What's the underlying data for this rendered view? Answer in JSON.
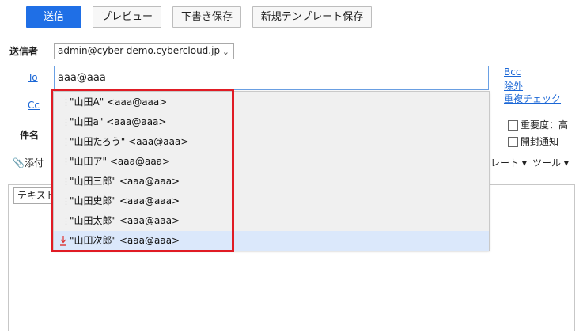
{
  "toolbar": {
    "send": "送信",
    "preview": "プレビュー",
    "save_draft": "下書き保存",
    "save_template": "新規テンプレート保存"
  },
  "sender": {
    "label": "送信者",
    "value": "admin@cyber-demo.cybercloud.jp"
  },
  "to": {
    "label": "To",
    "value": "aaa@aaa"
  },
  "cc": {
    "label": "Cc"
  },
  "subject": {
    "label": "件名"
  },
  "links": {
    "bcc": "Bcc",
    "exclude": "除外",
    "dup_check": "重複チェック"
  },
  "options": {
    "priority": "重要度：高",
    "read_receipt": "開封通知"
  },
  "attach": {
    "label": "添付"
  },
  "format": {
    "label": "テキスト"
  },
  "right_tools": {
    "template": "レート",
    "tools": "ツール"
  },
  "suggestions": [
    {
      "name": "\"山田A\"",
      "email": "<aaa@aaa>"
    },
    {
      "name": "\"山田a\"",
      "email": "<aaa@aaa>"
    },
    {
      "name": "\"山田たろう\"",
      "email": "<aaa@aaa>"
    },
    {
      "name": "\"山田ア\"",
      "email": "<aaa@aaa>"
    },
    {
      "name": "\"山田三郎\"",
      "email": "<aaa@aaa>"
    },
    {
      "name": "\"山田史郎\"",
      "email": "<aaa@aaa>"
    },
    {
      "name": "\"山田太郎\"",
      "email": "<aaa@aaa>"
    },
    {
      "name": "\"山田次郎\"",
      "email": "<aaa@aaa>"
    }
  ],
  "colors": {
    "accent": "#1f6fe6",
    "link": "#1b67d6",
    "highlight": "#e01b24",
    "active_row": "#dbe8fb"
  }
}
